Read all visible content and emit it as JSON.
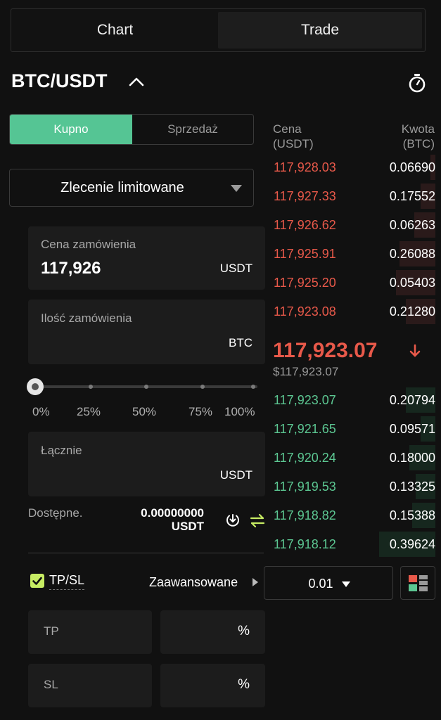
{
  "tabs": {
    "chart": "Chart",
    "trade": "Trade"
  },
  "pair": {
    "symbol": "BTC/USDT"
  },
  "side_toggle": {
    "buy": "Kupno",
    "sell": "Sprzedaż"
  },
  "order_type": {
    "selected": "Zlecenie limitowane"
  },
  "price_field": {
    "label": "Cena zamówienia",
    "value": "117,926",
    "unit": "USDT"
  },
  "qty_field": {
    "label": "Ilość zamówienia",
    "unit": "BTC"
  },
  "slider": {
    "value_percent": 0,
    "marks": [
      "0%",
      "25%",
      "50%",
      "75%",
      "100%"
    ]
  },
  "total_field": {
    "label": "Łącznie",
    "unit": "USDT"
  },
  "available": {
    "label": "Dostępne.",
    "amount": "0.00000000",
    "unit": "USDT"
  },
  "tpsl": {
    "label": "TP/SL",
    "checked": true,
    "advanced": "Zaawansowane",
    "tp_label": "TP",
    "sl_label": "SL",
    "pct": "%"
  },
  "orderbook": {
    "price_header_1": "Cena",
    "price_header_2": "(USDT)",
    "amount_header_1": "Kwota",
    "amount_header_2": "(BTC)",
    "asks": [
      {
        "price": "117,928.03",
        "amount": "0.06690",
        "depth": 0.03
      },
      {
        "price": "117,927.33",
        "amount": "0.17552",
        "depth": 0.09
      },
      {
        "price": "117,926.62",
        "amount": "0.06263",
        "depth": 0.13
      },
      {
        "price": "117,925.91",
        "amount": "0.26088",
        "depth": 0.22
      },
      {
        "price": "117,925.20",
        "amount": "0.05403",
        "depth": 0.24
      },
      {
        "price": "117,923.08",
        "amount": "0.21280",
        "depth": 0.18
      }
    ],
    "last_price": "117,923.07",
    "last_price_usd": "$117,923.07",
    "bids": [
      {
        "price": "117,923.07",
        "amount": "0.20794",
        "depth": 0.18
      },
      {
        "price": "117,921.65",
        "amount": "0.09571",
        "depth": 0.09
      },
      {
        "price": "117,920.24",
        "amount": "0.18000",
        "depth": 0.16
      },
      {
        "price": "117,919.53",
        "amount": "0.13325",
        "depth": 0.12
      },
      {
        "price": "117,918.82",
        "amount": "0.15388",
        "depth": 0.14
      },
      {
        "price": "117,918.12",
        "amount": "0.39624",
        "depth": 0.34
      }
    ],
    "tick_size": "0.01"
  },
  "colors": {
    "buy": "#55c594",
    "ask": "#e8594a",
    "bid": "#5cc792",
    "checkbox": "#c7ec63"
  },
  "icons": [
    "chevron-up-icon",
    "stopwatch-icon",
    "caret-down-icon",
    "deposit-icon",
    "transfer-icon",
    "arrow-down-icon",
    "caret-right-icon",
    "orderbook-layout-icon"
  ]
}
